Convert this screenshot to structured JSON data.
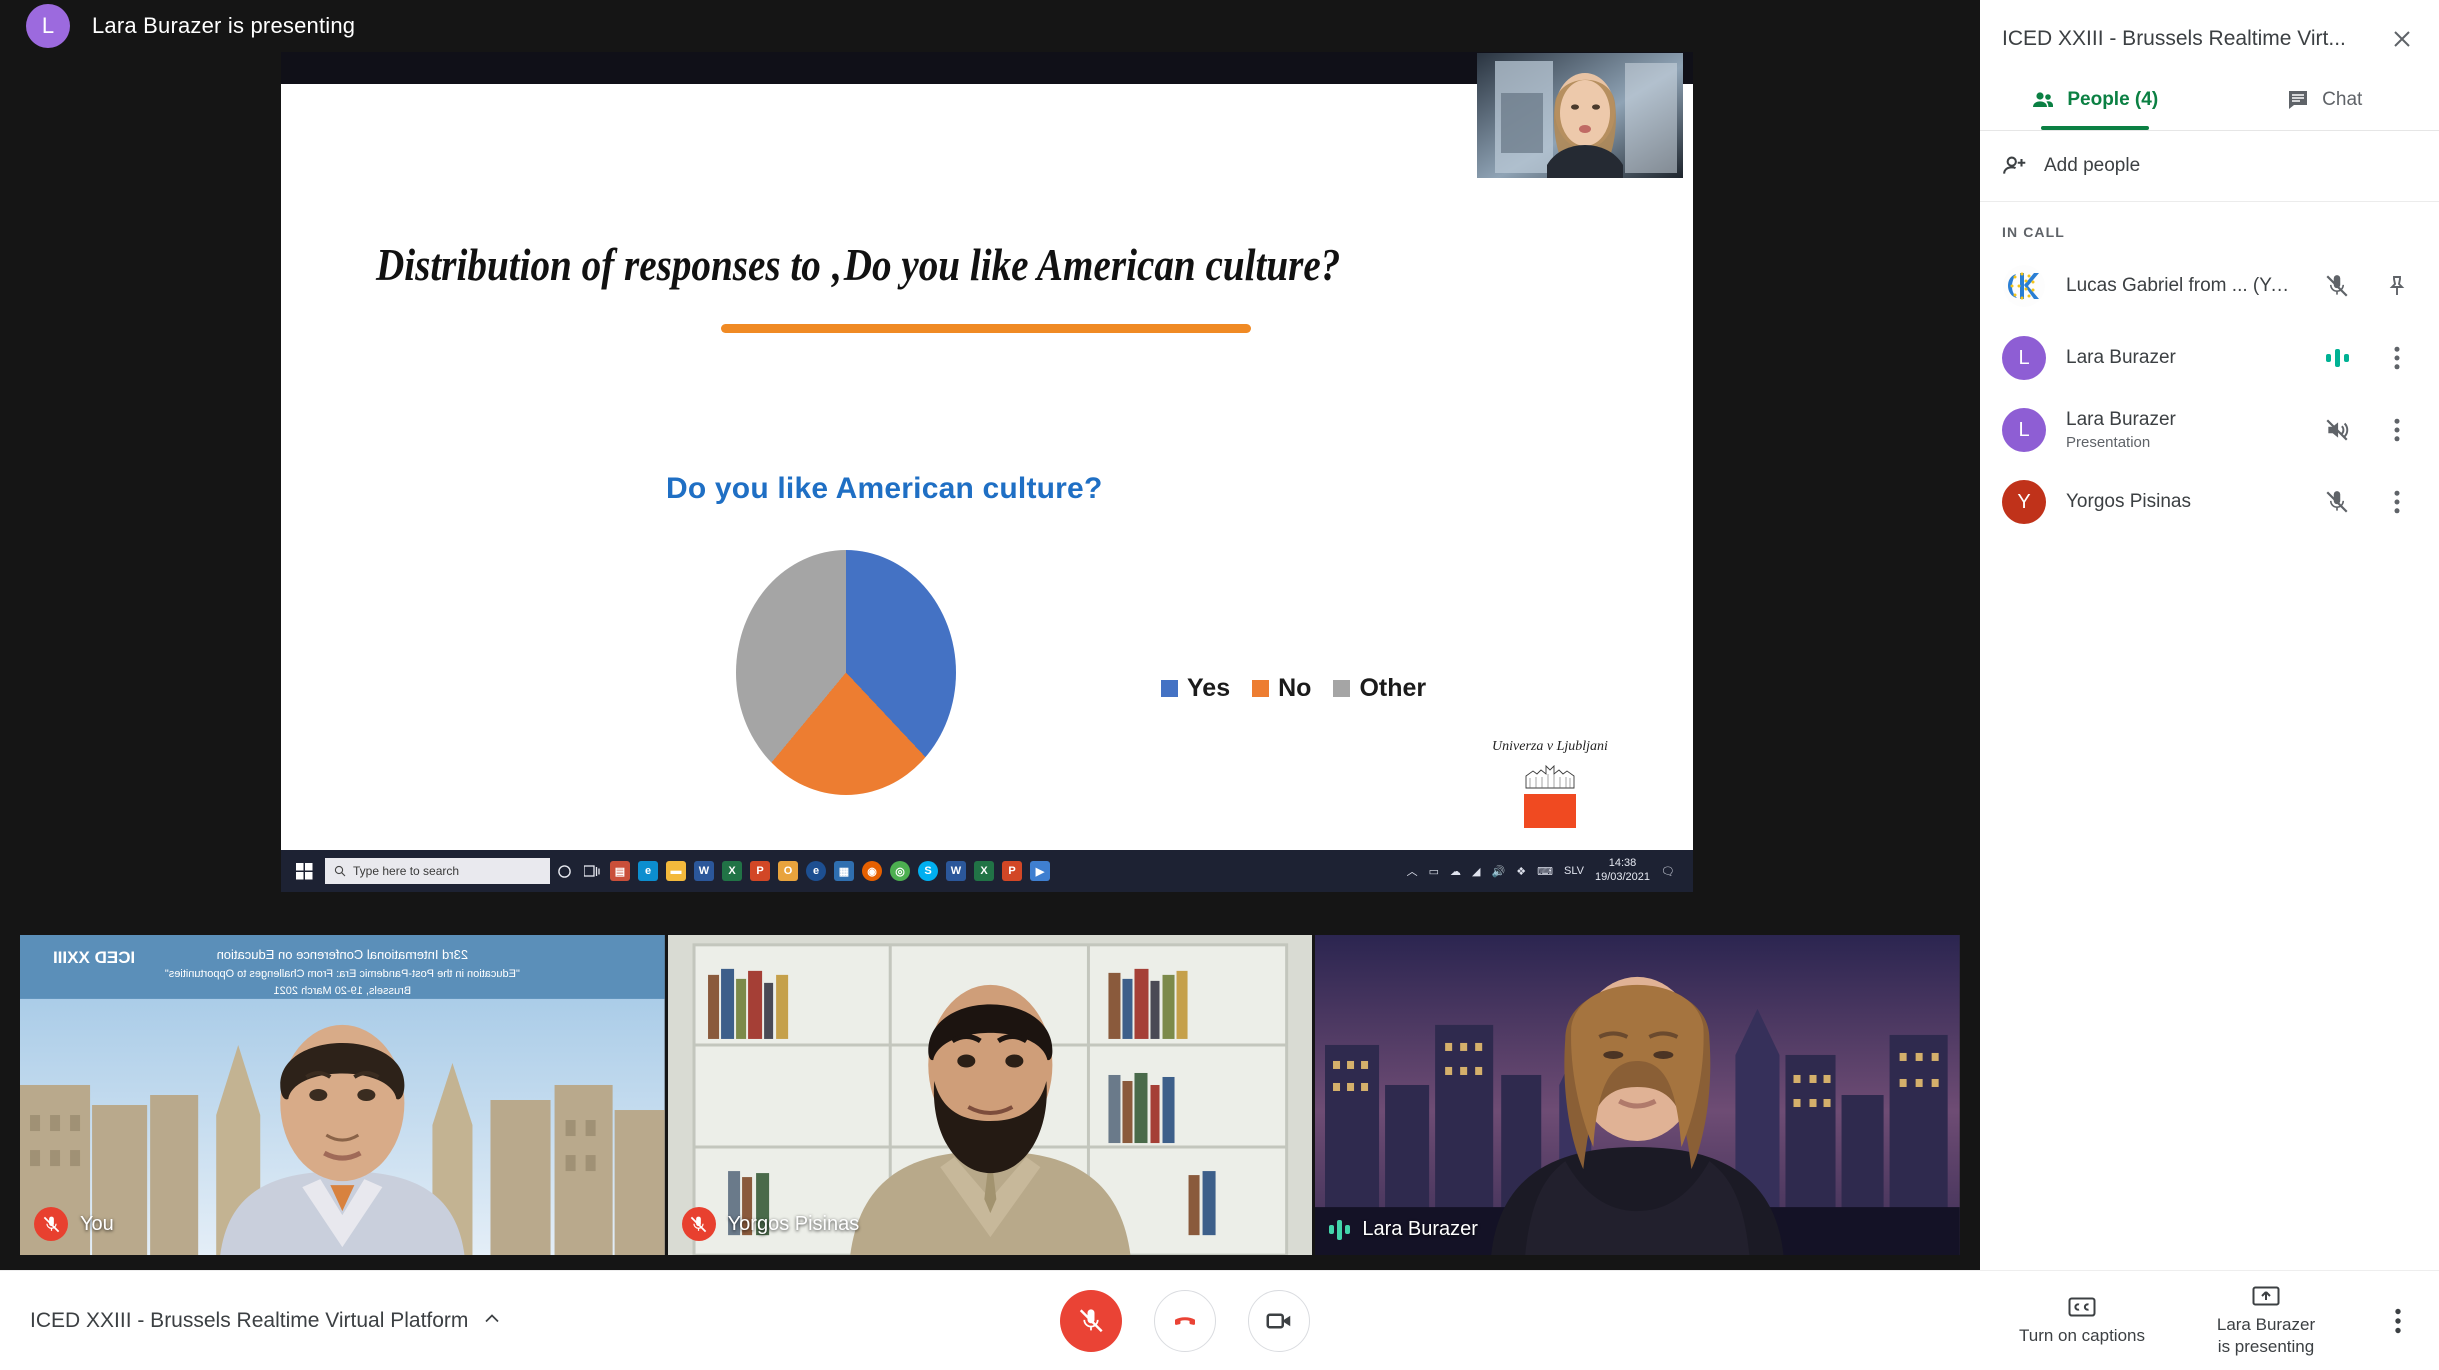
{
  "presenting_banner": {
    "avatar_initial": "L",
    "text": "Lara Burazer is presenting"
  },
  "shared_screen": {
    "window_controls": [
      "minimize",
      "maximize",
      "close"
    ],
    "slide": {
      "title": "Distribution of responses to ‚Do you like American culture?",
      "chart_title": "Do you like American culture?",
      "footer_logo_text": "Univerza v Ljubljani"
    },
    "taskbar": {
      "search_placeholder": "Type here to search",
      "clock_time": "14:38",
      "clock_date": "19/03/2021",
      "tray_label": "SLV",
      "app_icons": [
        "cortana-icon",
        "task-view-icon",
        "store-icon",
        "edge-icon",
        "file-explorer-icon",
        "word-icon",
        "excel-icon",
        "powerpoint-icon",
        "outlook-icon",
        "internet-explorer-icon",
        "calculator-icon",
        "firefox-icon",
        "chrome-icon",
        "skype-icon",
        "word-doc-icon",
        "excel-doc-icon",
        "powerpoint-doc-icon",
        "media-icon"
      ]
    }
  },
  "chart_data": {
    "type": "pie",
    "title": "Do you like American culture?",
    "categories": [
      "Yes",
      "No",
      "Other"
    ],
    "values": [
      38,
      23,
      39
    ],
    "colors": [
      "#4472c4",
      "#ed7d31",
      "#a5a5a5"
    ],
    "legend_position": "right",
    "data_labels": false,
    "xlabel": "",
    "ylabel": ""
  },
  "participant_tiles": [
    {
      "name": "You",
      "muted": true,
      "speaking": false
    },
    {
      "name": "Yorgos Pisinas",
      "muted": true,
      "speaking": false
    },
    {
      "name": "Lara Burazer",
      "muted": false,
      "speaking": true
    }
  ],
  "bottom_bar": {
    "meeting_name": "ICED XXIII - Brussels Realtime Virtual Platform",
    "expand_icon": "chevron-up-icon",
    "mic_button": {
      "icon": "mic-off-icon",
      "state": "muted"
    },
    "hangup_button": {
      "icon": "call-end-icon"
    },
    "camera_button": {
      "icon": "video-camera-icon",
      "state": "on"
    },
    "captions": {
      "icon": "closed-caption-icon",
      "label": "Turn on captions"
    },
    "present": {
      "icon": "present-to-all-icon",
      "label_line1": "Lara Burazer",
      "label_line2": "is presenting"
    },
    "more_options": {
      "icon": "more-vertical-icon"
    }
  },
  "side_panel": {
    "title": "ICED XXIII - Brussels Realtime Virt...",
    "close_icon": "close-icon",
    "tabs": [
      {
        "label": "People (4)",
        "icon": "people-icon",
        "active": true
      },
      {
        "label": "Chat",
        "icon": "chat-icon",
        "active": false
      }
    ],
    "add_people": {
      "label": "Add people",
      "icon": "person-add-icon"
    },
    "section_label": "IN CALL",
    "participants": [
      {
        "name": "Lucas Gabriel from ... (You)",
        "sub": "",
        "avatar_initial": "",
        "avatar_color": "#ffffff",
        "avatar_type": "logo",
        "status_icon": "mic-off-icon",
        "action_icon": "pin-icon",
        "speaking": false
      },
      {
        "name": "Lara Burazer",
        "sub": "",
        "avatar_initial": "L",
        "avatar_color": "#8e5ed4",
        "avatar_type": "initial",
        "status_icon": "speaking-bars",
        "action_icon": "more-vertical-icon",
        "speaking": true
      },
      {
        "name": "Lara Burazer",
        "sub": "Presentation",
        "avatar_initial": "L",
        "avatar_color": "#8e5ed4",
        "avatar_type": "initial",
        "status_icon": "volume-off-icon",
        "action_icon": "more-vertical-icon",
        "speaking": false
      },
      {
        "name": "Yorgos Pisinas",
        "sub": "",
        "avatar_initial": "Y",
        "avatar_color": "#c0321a",
        "avatar_type": "initial",
        "status_icon": "mic-off-icon",
        "action_icon": "more-vertical-icon",
        "speaking": false
      }
    ]
  },
  "conference_backdrop": {
    "line1": "23rd International Conference on Education",
    "line2": "\"Education in the Post-Pandemic Era: From Challenges to Opportunities\"",
    "line3": "Brussels, 19-20 March 2021",
    "logo": "ICED XXIII"
  },
  "colors": {
    "accent_green": "#0b8043",
    "danger_red": "#ea4335",
    "speaking_teal": "#00b294",
    "slide_accent_orange": "#f08a24",
    "chart_title_blue": "#1f6fc4"
  }
}
